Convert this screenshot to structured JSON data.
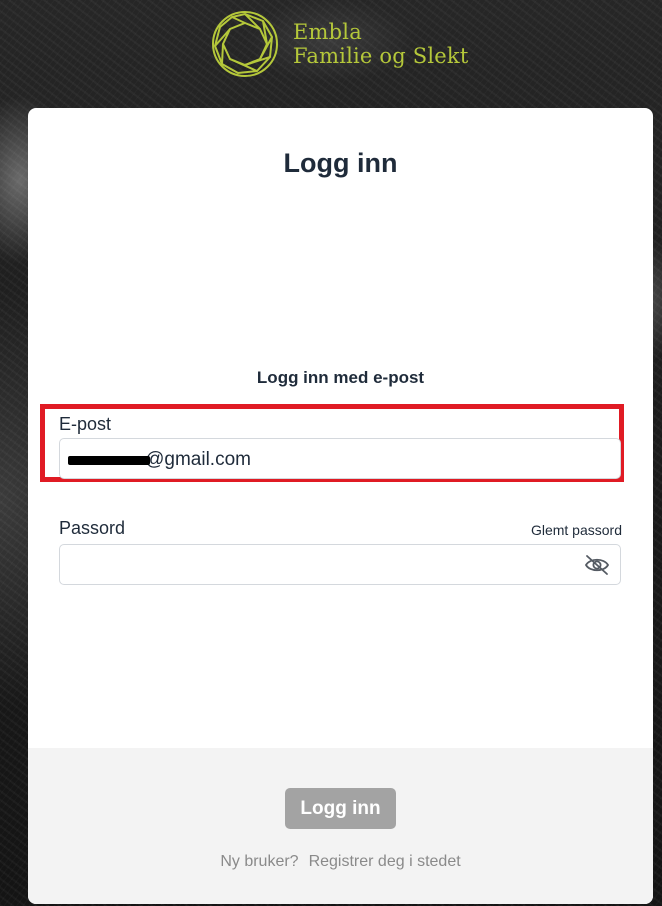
{
  "brand": {
    "line1": "Embla",
    "line2": "Familie og Slekt",
    "color": "#b5c83a",
    "icon": "faceted-gem-logo-icon"
  },
  "login": {
    "title": "Logg inn",
    "subtitle": "Logg inn med e-post",
    "email_label": "E-post",
    "email_value": "hirunitest@gmail.com",
    "email_visible_text": "@gmail.com",
    "password_label": "Passord",
    "forgot_password": "Glemt passord",
    "password_toggle_icon": "eye-slash-icon",
    "submit_label": "Logg inn",
    "new_user_text": "Ny bruker?",
    "register_link": "Registrer deg i stedet"
  },
  "colors": {
    "highlight_border": "#e01b24",
    "text": "#1f2b3a",
    "disabled_button": "#a3a3a3",
    "footer_background": "#f3f3f3"
  }
}
